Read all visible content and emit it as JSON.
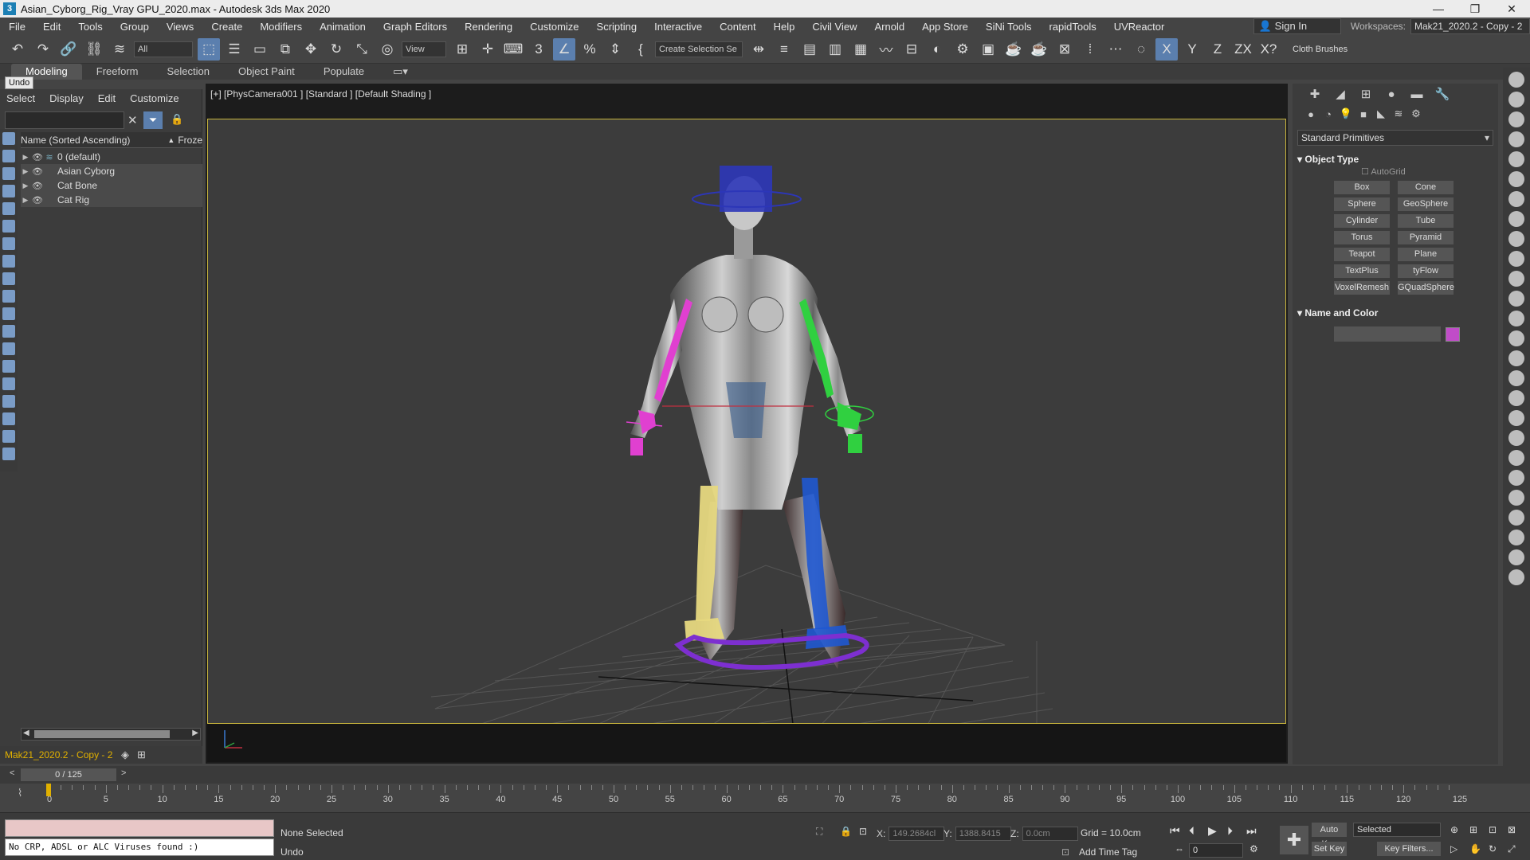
{
  "window": {
    "title": "Asian_Cyborg_Rig_Vray GPU_2020.max - Autodesk 3ds Max 2020",
    "controls": [
      "—",
      "❐",
      "✕"
    ]
  },
  "menu": {
    "items": [
      "File",
      "Edit",
      "Tools",
      "Group",
      "Views",
      "Create",
      "Modifiers",
      "Animation",
      "Graph Editors",
      "Rendering",
      "Customize",
      "Scripting",
      "Interactive",
      "Content",
      "Help",
      "Civil View",
      "Arnold",
      "App Store",
      "SiNi Tools",
      "rapidTools",
      "UVReactor"
    ],
    "sign_in": "Sign In",
    "workspaces_label": "Workspaces:",
    "workspace_value": "Mak21_2020.2 - Copy - 2"
  },
  "toolbar": {
    "filter_value": "All",
    "ref_coord": "View",
    "named_selection": "Create Selection Se",
    "axis_x": "X",
    "axis_y": "Y",
    "axis_z": "Z",
    "axis_zx": "ZX",
    "axis_xy": "X?",
    "cloth_brushes": "Cloth Brushes"
  },
  "ribbon": {
    "tabs": [
      "Modeling",
      "Freeform",
      "Selection",
      "Object Paint",
      "Populate"
    ]
  },
  "tooltip": {
    "undo": "Undo"
  },
  "scene_explorer": {
    "menu": [
      "Select",
      "Display",
      "Edit",
      "Customize"
    ],
    "column_name": "Name (Sorted Ascending)",
    "column_frozen": "Froze",
    "rows": [
      {
        "name": "0 (default)"
      },
      {
        "name": "Asian Cyborg"
      },
      {
        "name": "Cat Bone"
      },
      {
        "name": "Cat Rig"
      }
    ],
    "workspace_name": "Mak21_2020.2 - Copy - 2"
  },
  "viewport": {
    "label": "[+] [PhysCamera001 ] [Standard ] [Default Shading ]"
  },
  "command_panel": {
    "category": "Standard Primitives",
    "object_type_title": "Object Type",
    "autogrid": "AutoGrid",
    "buttons": [
      "Box",
      "Cone",
      "Sphere",
      "GeoSphere",
      "Cylinder",
      "Tube",
      "Torus",
      "Pyramid",
      "Teapot",
      "Plane",
      "TextPlus",
      "tyFlow",
      "VoxelRemesh",
      "GQuadSphere"
    ],
    "name_color_title": "Name and Color",
    "swatch_color": "#c04cc8"
  },
  "timeline": {
    "frame_display": "0 / 125",
    "tick_labels": [
      "0",
      "5",
      "10",
      "15",
      "20",
      "25",
      "30",
      "35",
      "40",
      "45",
      "50",
      "55",
      "60",
      "65",
      "70",
      "75",
      "80",
      "85",
      "90",
      "95",
      "100",
      "105",
      "110",
      "115",
      "120",
      "125"
    ]
  },
  "status": {
    "maxscript_output": "No CRP, ADSL or ALC Viruses found :)",
    "selection": "None Selected",
    "prompt": "Undo",
    "x_label": "X:",
    "x_value": "149.2684cl",
    "y_label": "Y:",
    "y_value": "1388.8415",
    "z_label": "Z:",
    "z_value": "0.0cm",
    "grid": "Grid = 10.0cm",
    "add_time_tag": "Add Time Tag",
    "auto_key": "Auto Key",
    "set_key": "Set Key",
    "key_selected": "Selected",
    "key_filters": "Key Filters...",
    "current_frame": "0"
  }
}
